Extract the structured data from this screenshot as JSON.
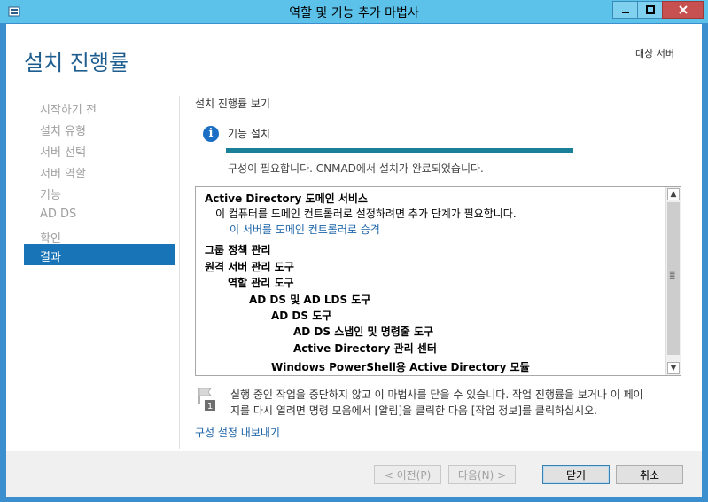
{
  "window": {
    "title": "역할 및 기능 추가 마법사",
    "controls": {
      "minimize": "▁",
      "maximize": "□",
      "close": "✕"
    }
  },
  "header": {
    "title": "설치 진행률",
    "destination_server_label": "대상 서버"
  },
  "nav": {
    "items": [
      {
        "label": "시작하기 전",
        "selected": false
      },
      {
        "label": "설치 유형",
        "selected": false
      },
      {
        "label": "서버 선택",
        "selected": false
      },
      {
        "label": "서버 역할",
        "selected": false
      },
      {
        "label": "기능",
        "selected": false
      },
      {
        "label": "AD DS",
        "selected": false
      },
      {
        "label": "확인",
        "selected": false
      },
      {
        "label": "결과",
        "selected": true
      }
    ]
  },
  "main": {
    "section_title": "설치 진행률 보기",
    "feature_install_label": "기능 설치",
    "progress_fraction": 1.0,
    "status_text": "구성이 필요합니다. CNMAD에서 설치가 완료되었습니다.",
    "results": [
      {
        "text": "Active Directory 도메인 서비스",
        "bold": true,
        "link": false
      },
      {
        "text": "이 컴퓨터를 도메인 컨트롤러로 설정하려면 추가 단계가 필요합니다.",
        "bold": false,
        "link": false
      },
      {
        "text": "이 서버를 도메인 컨트롤러로 승격",
        "bold": false,
        "link": true
      },
      {
        "text": "그룹 정책 관리",
        "bold": true,
        "link": false
      },
      {
        "text": "원격 서버 관리 도구",
        "bold": true,
        "link": false
      },
      {
        "text": "역할 관리 도구",
        "bold": true,
        "link": false
      },
      {
        "text": "AD DS 및 AD LDS 도구",
        "bold": true,
        "link": false
      },
      {
        "text": "AD DS 도구",
        "bold": true,
        "link": false
      },
      {
        "text": "AD DS 스냅인 및 명령줄 도구",
        "bold": true,
        "link": false
      },
      {
        "text": "Active Directory 관리 센터",
        "bold": true,
        "link": false
      },
      {
        "text": "Windows PowerShell용 Active Directory 모듈",
        "bold": true,
        "link": false
      }
    ],
    "note_badge": "1",
    "note_line1": "실행 중인 작업을 중단하지 않고 이 마법사를 닫을 수 있습니다. 작업 진행률을 보거나 이 페이",
    "note_line2": "지를 다시 열려면 명령 모음에서 [알림]을 클릭한 다음 [작업 정보]를 클릭하십시오.",
    "export_link": "구성 설정 내보내기"
  },
  "footer": {
    "prev_label": "< 이전(P)",
    "next_label": "다음(N) >",
    "close_label": "닫기",
    "cancel_label": "취소"
  },
  "colors": {
    "titlebar": "#5cc2ea",
    "accent": "#1874b6",
    "heading": "#1d5d8f",
    "progress": "#1a7f99",
    "link": "#1b63a8"
  }
}
